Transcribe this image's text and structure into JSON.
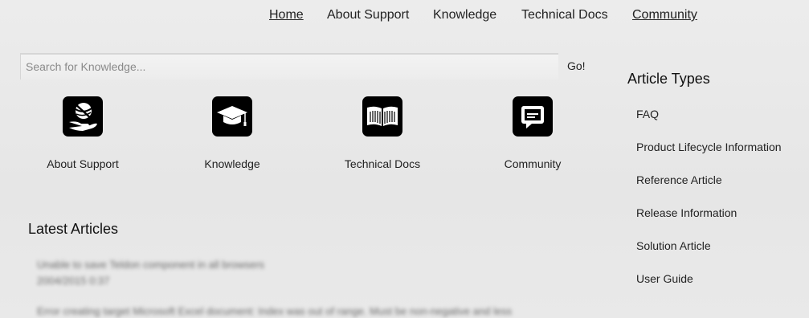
{
  "topnav": {
    "items": [
      {
        "label": "Home"
      },
      {
        "label": "About Support"
      },
      {
        "label": "Knowledge"
      },
      {
        "label": "Technical Docs"
      },
      {
        "label": "Community"
      }
    ]
  },
  "search": {
    "placeholder": "Search for Knowledge...",
    "value": "",
    "button_label": "Go!"
  },
  "tiles": [
    {
      "label": "About Support",
      "icon": "hand-globe-icon"
    },
    {
      "label": "Knowledge",
      "icon": "graduation-cap-icon"
    },
    {
      "label": "Technical Docs",
      "icon": "open-book-icon"
    },
    {
      "label": "Community",
      "icon": "chat-bubble-icon"
    }
  ],
  "latest": {
    "title": "Latest Articles",
    "articles": [
      {
        "title": "Unable to save Teldon component in all browsers",
        "meta": "2004/2015 0:37"
      },
      {
        "title": "Error creating target Microsoft Excel document: Index was out of range. Must be non-negative and less"
      }
    ]
  },
  "sidebar": {
    "title": "Article Types",
    "items": [
      {
        "label": "FAQ"
      },
      {
        "label": "Product Lifecycle Information"
      },
      {
        "label": "Reference Article"
      },
      {
        "label": "Release Information"
      },
      {
        "label": "Solution Article"
      },
      {
        "label": "User Guide"
      }
    ]
  }
}
